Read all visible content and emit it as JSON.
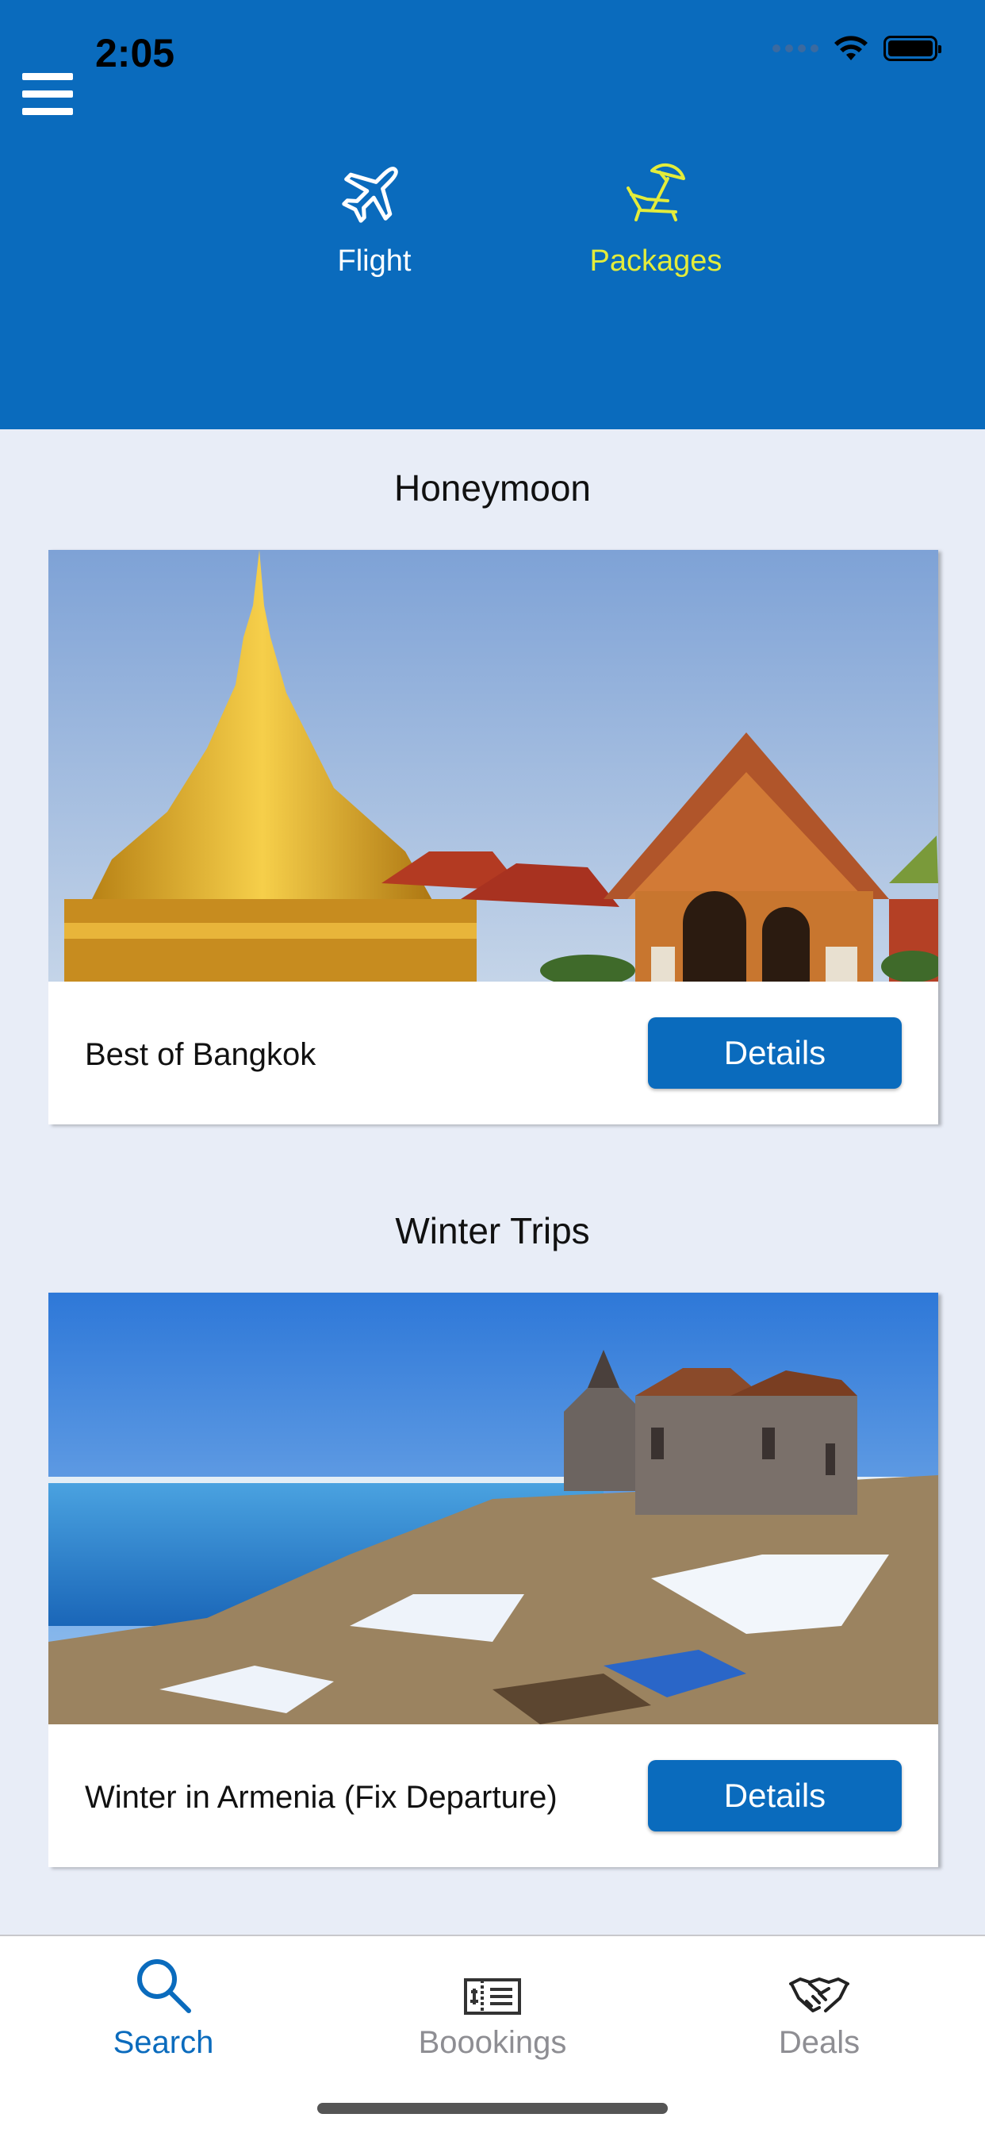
{
  "status_bar": {
    "time": "2:05"
  },
  "header": {
    "menu_icon": "hamburger-menu-icon",
    "options": [
      {
        "label": "Flight",
        "icon": "airplane-icon",
        "selected": false,
        "color": "#ffffff"
      },
      {
        "label": "Packages",
        "icon": "beach-chair-umbrella-icon",
        "selected": true,
        "color": "#e3ec3b"
      }
    ],
    "background_color": "#0a6bbd"
  },
  "sections": [
    {
      "title": "Honeymoon",
      "package": {
        "name": "Best of Bangkok",
        "button_label": "Details",
        "image": "golden-temple-photo"
      }
    },
    {
      "title": "Winter Trips",
      "package": {
        "name": "Winter in Armenia (Fix Departure)",
        "button_label": "Details",
        "image": "lakeside-monastery-snow-photo"
      }
    }
  ],
  "tabbar": {
    "tabs": [
      {
        "label": "Search",
        "icon": "magnifier-icon",
        "active": true
      },
      {
        "label": "Boookings",
        "icon": "ticket-icon",
        "active": false
      },
      {
        "label": "Deals",
        "icon": "handshake-icon",
        "active": false
      }
    ],
    "active_color": "#0a6bbd",
    "inactive_color": "#8e8e93"
  }
}
